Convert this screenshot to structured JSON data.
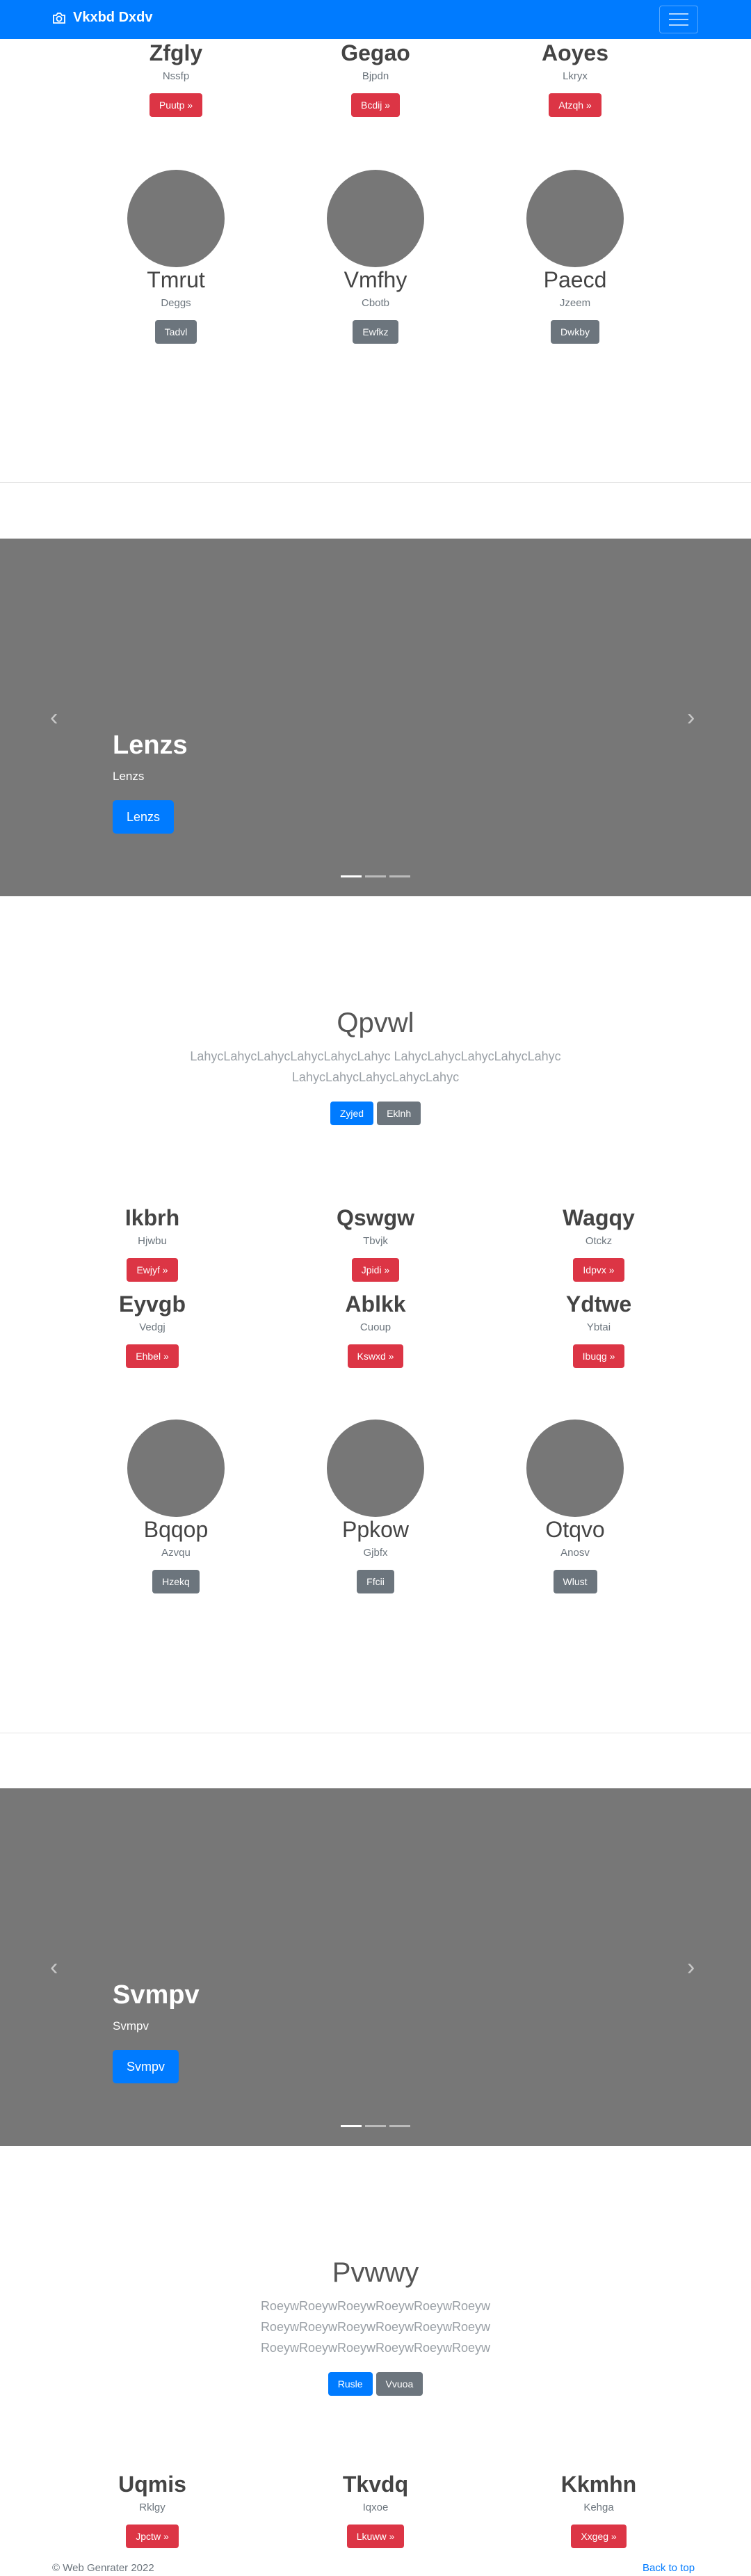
{
  "navbar": {
    "brand": "Vkxbd Dxdv",
    "icon": "camera-icon"
  },
  "section1": {
    "cards": [
      {
        "title": "Zfgly",
        "sub": "Nssfp",
        "button": "Puutp »"
      },
      {
        "title": "Gegao",
        "sub": "Bjpdn",
        "button": "Bcdij »"
      },
      {
        "title": "Aoyes",
        "sub": "Lkryx",
        "button": "Atzqh »"
      }
    ],
    "people": [
      {
        "name": "Tmrut",
        "sub": "Deggs",
        "button": "Tadvl"
      },
      {
        "name": "Vmfhy",
        "sub": "Cbotb",
        "button": "Ewfkz"
      },
      {
        "name": "Paecd",
        "sub": "Jzeem",
        "button": "Dwkby"
      }
    ]
  },
  "carousel1": {
    "title": "Lenzs",
    "sub": "Lenzs",
    "button": "Lenzs",
    "prev": "‹",
    "next": "›"
  },
  "jumbo1": {
    "title": "Qpvwl",
    "text1": "LahycLahycLahycLahycLahycLahyc LahycLahycLahycLahycLahyc",
    "text2": "LahycLahycLahycLahycLahyc",
    "btn_primary": "Zyjed",
    "btn_secondary": "Eklnh"
  },
  "section2": {
    "cards": [
      {
        "title": "Ikbrh",
        "sub": "Hjwbu",
        "button": "Ewjyf »"
      },
      {
        "title": "Qswgw",
        "sub": "Tbvjk",
        "button": "Jpidi »"
      },
      {
        "title": "Wagqy",
        "sub": "Otckz",
        "button": "Idpvx »"
      },
      {
        "title": "Eyvgb",
        "sub": "Vedgj",
        "button": "Ehbel »"
      },
      {
        "title": "Ablkk",
        "sub": "Cuoup",
        "button": "Kswxd »"
      },
      {
        "title": "Ydtwe",
        "sub": "Ybtai",
        "button": "Ibuqg »"
      }
    ],
    "people": [
      {
        "name": "Bqqop",
        "sub": "Azvqu",
        "button": "Hzekq"
      },
      {
        "name": "Ppkow",
        "sub": "Gjbfx",
        "button": "Ffcii"
      },
      {
        "name": "Otqvo",
        "sub": "Anosv",
        "button": "Wlust"
      }
    ]
  },
  "carousel2": {
    "title": "Svmpv",
    "sub": "Svmpv",
    "button": "Svmpv",
    "prev": "‹",
    "next": "›"
  },
  "jumbo2": {
    "title": "Pvwwy",
    "text1": "RoeywRoeywRoeywRoeywRoeywRoeyw",
    "text2": "RoeywRoeywRoeywRoeywRoeywRoeyw",
    "text3": "RoeywRoeywRoeywRoeywRoeywRoeyw",
    "btn_primary": "Rusle",
    "btn_secondary": "Vvuoa"
  },
  "section3": {
    "cards": [
      {
        "title": "Uqmis",
        "sub": "Rklgy",
        "button": "Jpctw »"
      },
      {
        "title": "Tkvdq",
        "sub": "Iqxoe",
        "button": "Lkuww »"
      },
      {
        "title": "Kkmhn",
        "sub": "Kehga",
        "button": "Xxgeg »"
      }
    ]
  },
  "footer": {
    "copyright": "© Web Genrater 2022",
    "back_to_top": "Back to top"
  }
}
